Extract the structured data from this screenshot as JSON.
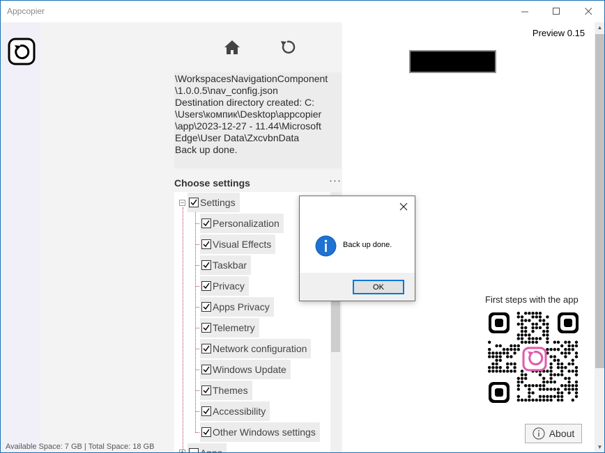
{
  "window": {
    "title": "Appcopier",
    "preview": "Preview 0.15"
  },
  "log_text": "\\WorkspacesNavigationComponent\n\\1.0.0.5\\nav_config.json\nDestination directory created: C:\n\\Users\\компик\\Desktop\\appcopier\n\\app\\2023-12-27 - 11.44\\Microsoft\nEdge\\User Data\\ZxcvbnData\nBack up done.",
  "settings": {
    "title": "Choose settings",
    "more": "···",
    "root": {
      "label": "Settings",
      "checked": true,
      "expander": "−"
    },
    "items": [
      {
        "label": "Personalization",
        "checked": true
      },
      {
        "label": "Visual Effects",
        "checked": true
      },
      {
        "label": "Taskbar",
        "checked": true
      },
      {
        "label": "Privacy",
        "checked": true
      },
      {
        "label": "Apps Privacy",
        "checked": true
      },
      {
        "label": "Telemetry",
        "checked": true
      },
      {
        "label": "Network configuration",
        "checked": true
      },
      {
        "label": "Windows Update",
        "checked": true
      },
      {
        "label": "Themes",
        "checked": true
      },
      {
        "label": "Accessibility",
        "checked": true
      },
      {
        "label": "Other Windows settings",
        "checked": true
      }
    ],
    "next_root": {
      "label": "Apps",
      "checked": false,
      "expander": "+"
    }
  },
  "qr": {
    "title": "First steps with the app"
  },
  "about": {
    "label": "About"
  },
  "status": {
    "text": "Available Space: 7 GB | Total Space: 18 GB"
  },
  "dialog": {
    "message": "Back up done.",
    "ok_label": "OK"
  },
  "colors": {
    "accent": "#0078d7",
    "qr_logo": "#e05aa8",
    "rail": "#f1f0f9"
  }
}
